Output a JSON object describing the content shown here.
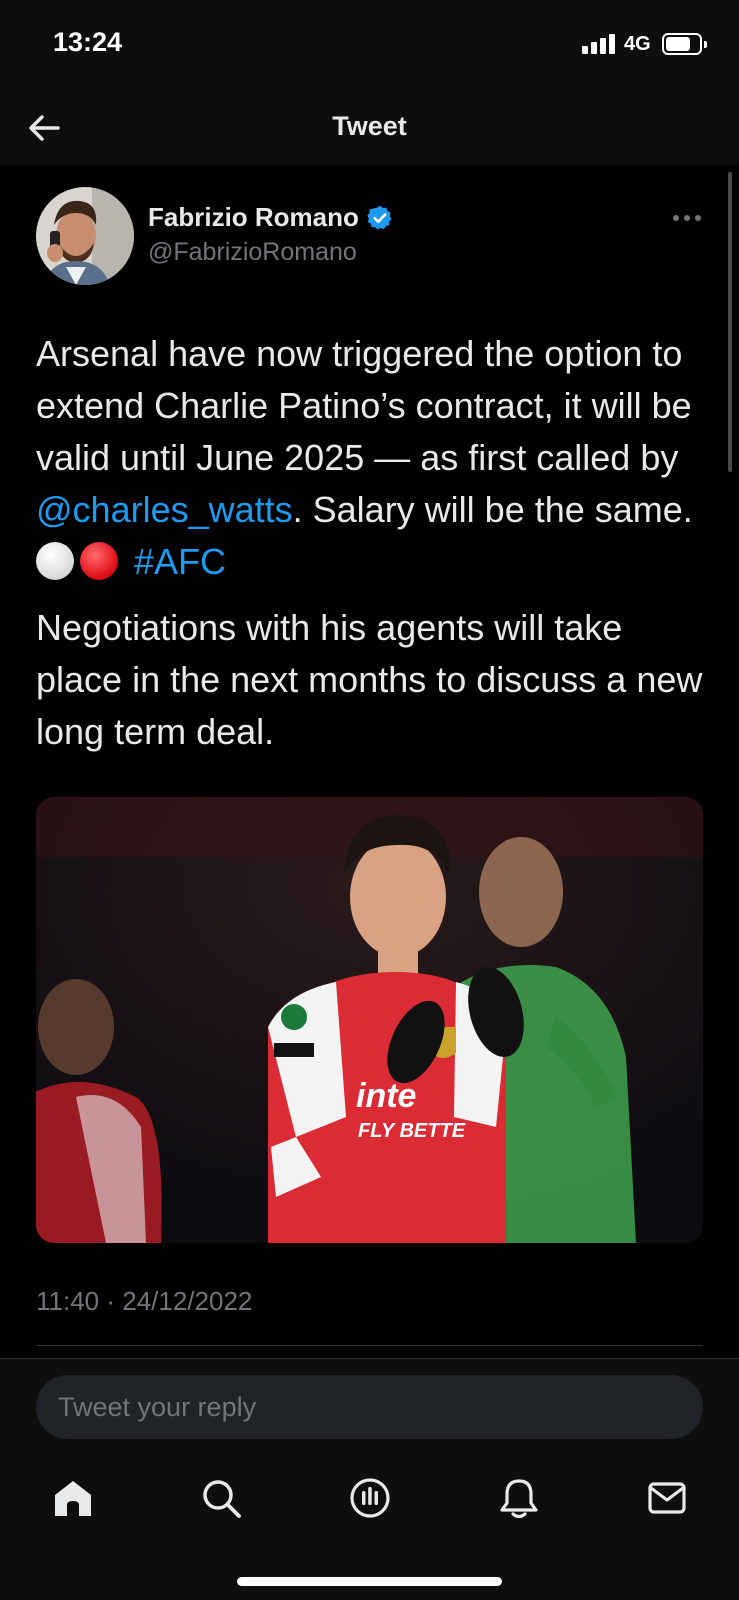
{
  "status_bar": {
    "time": "13:24",
    "network": "4G"
  },
  "header": {
    "title": "Tweet",
    "back_icon": "arrow-left-icon"
  },
  "tweet": {
    "author": {
      "name": "Fabrizio Romano",
      "handle": "@FabrizioRomano",
      "verified": true,
      "verified_color": "#1d9bf0"
    },
    "paragraph1": {
      "text_a": "Arsenal have now triggered the option to extend Charlie Patino’s contract, it will be valid until June 2025 — as first called by ",
      "mention": "@charles_watts",
      "text_b": ". Salary will be the same. ",
      "emojis": [
        "white-circle",
        "red-circle"
      ],
      "hashtag": "#AFC"
    },
    "paragraph2": "Negotiations with his agents will take place in the next months to discuss a new long term deal.",
    "timestamp": "11:40 · 24/12/2022"
  },
  "reply": {
    "placeholder": "Tweet your reply"
  },
  "tabbar": {
    "items": [
      "home-icon",
      "search-icon",
      "spaces-icon",
      "notifications-icon",
      "messages-icon"
    ]
  },
  "colors": {
    "background": "#000000",
    "link": "#1d9bf0",
    "secondary_text": "#71767b",
    "primary_text": "#e7e9ea"
  }
}
